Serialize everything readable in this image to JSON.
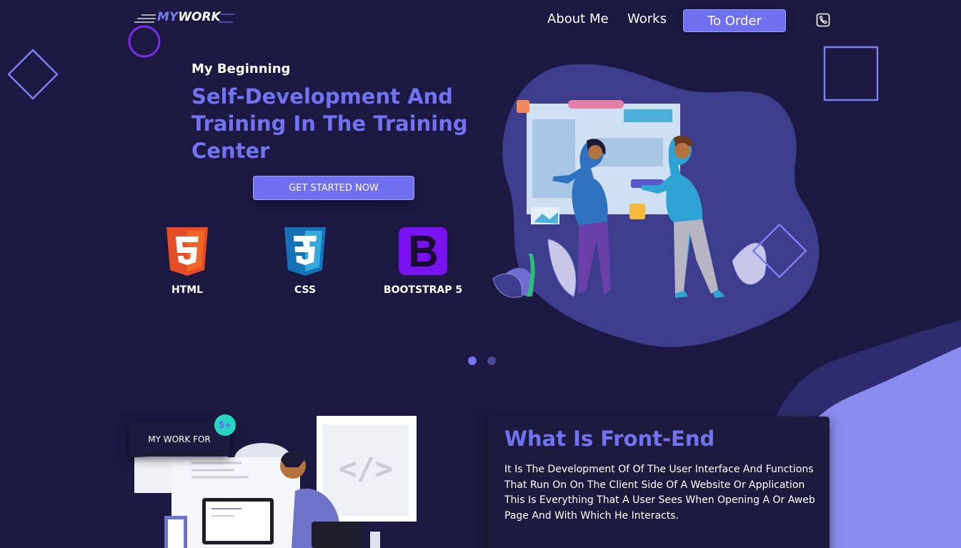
{
  "header": {
    "logo_my": "MY",
    "logo_work": "WORK",
    "nav": [
      "About Me",
      "Works"
    ],
    "order_label": "To Order"
  },
  "hero": {
    "eyebrow": "My Beginning",
    "title": "Self-Development And Training In The Training Center",
    "cta_label": "GET STARTED NOW",
    "technologies": [
      {
        "name": "HTML",
        "icon": "html5-icon"
      },
      {
        "name": "CSS",
        "icon": "css3-icon"
      },
      {
        "name": "BOOTSTRAP 5",
        "icon": "bootstrap-icon"
      }
    ],
    "carousel": {
      "slides": 2,
      "active": 1
    }
  },
  "about": {
    "badge_label": "MY WORK FOR",
    "badge_count": "5+",
    "title": "What Is Front-End",
    "body": "It Is The Development Of Of The User Interface And Functions That Run On On The Client Side Of A Website Or Application This Is Everything That A User Sees When Opening A Or Aweb Page And With Which He Interacts."
  },
  "colors": {
    "background": "#1b1941",
    "accent": "#7372f2",
    "button": "#6f6ff0",
    "blob": "#3e3c8c",
    "corner_shape": "#8a8bef",
    "badge_count_bg": "#27d3c3"
  }
}
